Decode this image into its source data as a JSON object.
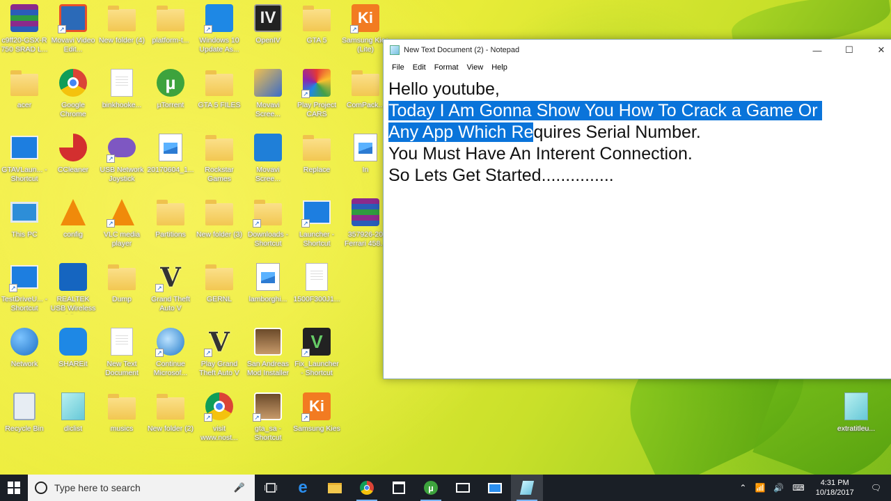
{
  "desktop": {
    "icons": [
      {
        "label": "c9ff20-GSX-R 750 SRAD L..."
      },
      {
        "label": "Movavi Video Edit..."
      },
      {
        "label": "New folder (4)"
      },
      {
        "label": "platform-t..."
      },
      {
        "label": "Windows 10 Update As..."
      },
      {
        "label": "OpenIV"
      },
      {
        "label": "GTA 5"
      },
      {
        "label": "Samsung Kies (Lite)"
      },
      {
        "label": "acer"
      },
      {
        "label": "Google Chrome"
      },
      {
        "label": "binkhooke..."
      },
      {
        "label": "µTorrent"
      },
      {
        "label": "GTA 5 FILES"
      },
      {
        "label": "Movavi Scree..."
      },
      {
        "label": "Play Project CARS"
      },
      {
        "label": "ComPack..."
      },
      {
        "label": "GTAVLaun... - Shortcut"
      },
      {
        "label": "CCleaner"
      },
      {
        "label": "USB Network Joystick"
      },
      {
        "label": "20170604_1..."
      },
      {
        "label": "Rockstar Games"
      },
      {
        "label": "Movavi Scree..."
      },
      {
        "label": "Replace"
      },
      {
        "label": "In"
      },
      {
        "label": "This PC"
      },
      {
        "label": "config"
      },
      {
        "label": "VLC media player"
      },
      {
        "label": "Partitions"
      },
      {
        "label": "New folder (3)"
      },
      {
        "label": "Downloads - Shortcut"
      },
      {
        "label": "Launcher - Shortcut"
      },
      {
        "label": "357926-20 Ferrari 458..."
      },
      {
        "label": "TestDriveU... - Shortcut"
      },
      {
        "label": "REALTEK USB Wireless LA..."
      },
      {
        "label": "Dump"
      },
      {
        "label": "Grand Theft Auto V"
      },
      {
        "label": "GERNL"
      },
      {
        "label": "lamborghi..."
      },
      {
        "label": "1500F300J1..."
      },
      {
        "label": "Network"
      },
      {
        "label": "SHAREit"
      },
      {
        "label": "New Text Document"
      },
      {
        "label": "Continue Microsof..."
      },
      {
        "label": "Play Grand Theft Auto V"
      },
      {
        "label": "San Andreas Mod Installer"
      },
      {
        "label": "Fix_Launcher - Shortcut"
      },
      {
        "label": "Recycle Bin"
      },
      {
        "label": "dlclist"
      },
      {
        "label": "musics"
      },
      {
        "label": "New folder (2)"
      },
      {
        "label": "visit www.nost..."
      },
      {
        "label": "gta_sa - Shortcut"
      },
      {
        "label": "Samsung Kies"
      },
      {
        "label": "extratitleu..."
      }
    ]
  },
  "notepad": {
    "title": "New Text Document (2) - Notepad",
    "menu": [
      "File",
      "Edit",
      "Format",
      "View",
      "Help"
    ],
    "lines": {
      "l1": "Hello youtube,",
      "l2": "Today I Am Gonna Show You How To Crack a Game Or ",
      "l3_sel": "Any App Which Re",
      "l3_rest": "quires Serial Number.",
      "l4": "You Must Have An Interent Connection.",
      "l5": "So Lets Get Started..............."
    },
    "controls": {
      "minimize": "—",
      "maximize": "☐",
      "close": "✕"
    }
  },
  "taskbar": {
    "search_placeholder": "Type here to search",
    "apps": [
      "task-view",
      "edge",
      "file-explorer",
      "chrome",
      "store",
      "utorrent",
      "mail",
      "remote",
      "notepad"
    ],
    "clock_time": "4:31 PM",
    "clock_date": "10/18/2017"
  }
}
